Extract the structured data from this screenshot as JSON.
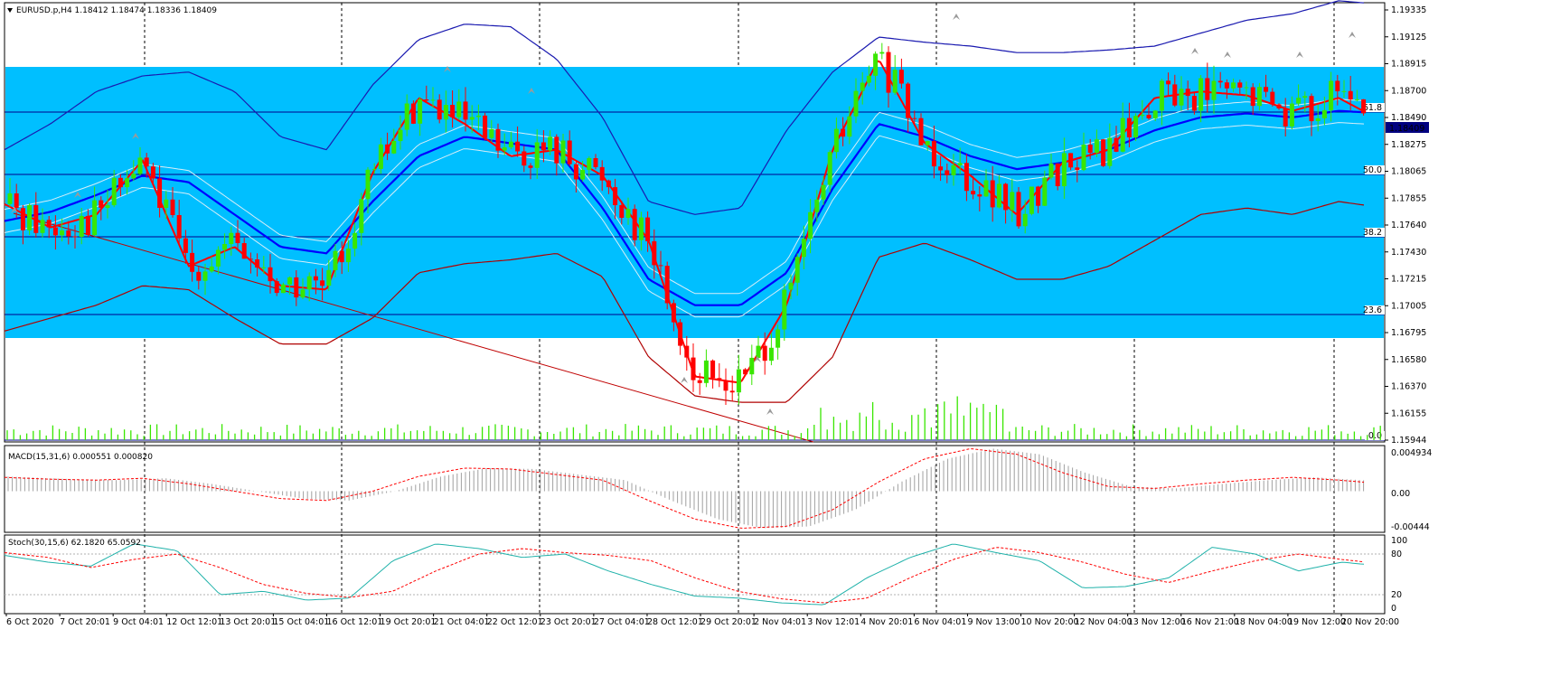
{
  "main": {
    "symbol_header": "EURUSD.p,H4  1.18412 1.18474 1.18336 1.18409",
    "price_scale": [
      "1.19335",
      "1.19125",
      "1.18915",
      "1.18700",
      "1.18490",
      "1.18275",
      "1.18065",
      "1.17855",
      "1.17640",
      "1.17430",
      "1.17215",
      "1.17005",
      "1.16795",
      "1.16580",
      "1.16370",
      "1.16155",
      "1.15944"
    ],
    "current_price": "1.18409",
    "fib_labels": [
      "61.8",
      "50.0",
      "38.2",
      "23.6",
      "0.0"
    ]
  },
  "macd": {
    "header": "MACD(15,31,6) 0.000551 0.000820",
    "scale": [
      "0.004934",
      "0.00",
      "-0.00444"
    ]
  },
  "stoch": {
    "header": "Stoch(30,15,6) 62.1820 65.0592",
    "scale": [
      "100",
      "80",
      "20",
      "0"
    ]
  },
  "time_axis": [
    "6 Oct 2020",
    "7 Oct 20:01",
    "9 Oct 04:01",
    "12 Oct 12:01",
    "13 Oct 20:01",
    "15 Oct 04:01",
    "16 Oct 12:01",
    "19 Oct 20:01",
    "21 Oct 04:01",
    "22 Oct 12:01",
    "23 Oct 20:01",
    "27 Oct 04:01",
    "28 Oct 12:01",
    "29 Oct 20:01",
    "2 Nov 04:01",
    "3 Nov 12:01",
    "4 Nov 20:01",
    "6 Nov 04:01",
    "9 Nov 13:00",
    "10 Nov 20:00",
    "12 Nov 04:00",
    "13 Nov 12:00",
    "16 Nov 21:00",
    "18 Nov 04:00",
    "19 Nov 12:00",
    "20 Nov 20:00"
  ],
  "colors": {
    "fib_zone": "#00bfff",
    "bull": "#39e600",
    "bear": "#ff0000",
    "ma_fast": "#ff0000",
    "ma_mid": "#0000ff",
    "volume": "#39e600",
    "macd_signal": "#ff0000",
    "stoch_main": "#20b2aa",
    "stoch_signal": "#ff0000"
  },
  "chart_data": [
    {
      "type": "line",
      "title": "EURUSD.p,H4",
      "ylim": [
        1.15944,
        1.19335
      ],
      "x": [
        "6 Oct 2020",
        "7 Oct 20:01",
        "9 Oct 04:01",
        "12 Oct 12:01",
        "13 Oct 20:01",
        "15 Oct 04:01",
        "16 Oct 12:01",
        "19 Oct 20:01",
        "21 Oct 04:01",
        "22 Oct 12:01",
        "23 Oct 20:01",
        "27 Oct 04:01",
        "28 Oct 12:01",
        "29 Oct 20:01",
        "2 Nov 04:01",
        "3 Nov 12:01",
        "4 Nov 20:01",
        "6 Nov 04:01",
        "9 Nov 13:00",
        "10 Nov 20:00",
        "12 Nov 04:00",
        "13 Nov 12:00",
        "16 Nov 21:00",
        "18 Nov 04:00",
        "19 Nov 12:00",
        "20 Nov 20:00"
      ],
      "series": [
        {
          "values": [
            1.1778,
            1.176,
            1.177,
            1.1812,
            1.173,
            1.1745,
            1.1715,
            1.1712,
            1.1802,
            1.186,
            1.184,
            1.1815,
            1.182,
            1.18,
            1.175,
            1.1645,
            1.164,
            1.17,
            1.182,
            1.189,
            1.1825,
            1.18,
            1.177,
            1.181,
            1.182,
            1.186,
            1.1865,
            1.1862,
            1.185,
            1.186,
            1.1841
          ]
        },
        {
          "values": [
            1.1765,
            1.1772,
            1.1785,
            1.18,
            1.1795,
            1.177,
            1.1745,
            1.174,
            1.178,
            1.1815,
            1.183,
            1.1825,
            1.182,
            1.1775,
            1.172,
            1.17,
            1.17,
            1.1725,
            1.179,
            1.184,
            1.183,
            1.1815,
            1.1805,
            1.181,
            1.182,
            1.1835,
            1.1845,
            1.1848,
            1.1845,
            1.185,
            1.1848
          ]
        },
        {
          "values": [
            1.182,
            1.184,
            1.1865,
            1.1877,
            1.188,
            1.1865,
            1.183,
            1.182,
            1.187,
            1.1905,
            1.1917,
            1.1915,
            1.189,
            1.1845,
            1.178,
            1.177,
            1.1775,
            1.1835,
            1.188,
            1.1907,
            1.1903,
            1.19,
            1.1895,
            1.1895,
            1.1897,
            1.19,
            1.191,
            1.192,
            1.1925,
            1.1935,
            1.1932
          ]
        },
        {
          "values": [
            1.168,
            1.169,
            1.17,
            1.1715,
            1.1712,
            1.169,
            1.167,
            1.167,
            1.169,
            1.1725,
            1.1732,
            1.1735,
            1.174,
            1.1722,
            1.166,
            1.163,
            1.1625,
            1.1625,
            1.166,
            1.1737,
            1.1748,
            1.1735,
            1.172,
            1.172,
            1.173,
            1.175,
            1.177,
            1.1775,
            1.177,
            1.178,
            1.1775
          ]
        }
      ]
    },
    {
      "type": "line",
      "title": "MACD(15,31,6) 0.000551 0.000820",
      "ylim": [
        -0.00444,
        0.004934
      ],
      "series": [
        {
          "values": [
            0.0015,
            0.0013,
            0.0012,
            0.0014,
            0.0008,
            0.0,
            -0.0008,
            -0.001,
            0.0,
            0.0016,
            0.0025,
            0.0024,
            0.0018,
            0.0012,
            -0.001,
            -0.003,
            -0.004,
            -0.0038,
            -0.002,
            0.001,
            0.0035,
            0.0046,
            0.004,
            0.002,
            0.0005,
            0.0003,
            0.0008,
            0.0012,
            0.0015,
            0.0012,
            0.0008
          ]
        }
      ]
    },
    {
      "type": "line",
      "title": "Stoch(30,15,6) 62.1820 65.0592",
      "ylim": [
        0,
        100
      ],
      "series": [
        {
          "values": [
            78,
            68,
            62,
            95,
            85,
            20,
            25,
            12,
            15,
            70,
            95,
            88,
            75,
            80,
            55,
            35,
            18,
            15,
            8,
            5,
            45,
            75,
            95,
            82,
            70,
            30,
            32,
            45,
            90,
            80,
            55,
            68,
            62
          ]
        },
        {
          "values": [
            82,
            75,
            60,
            72,
            80,
            60,
            35,
            22,
            16,
            25,
            55,
            80,
            88,
            82,
            78,
            70,
            45,
            25,
            14,
            8,
            15,
            45,
            72,
            90,
            82,
            68,
            50,
            38,
            55,
            70,
            80,
            72,
            65
          ]
        }
      ]
    }
  ]
}
